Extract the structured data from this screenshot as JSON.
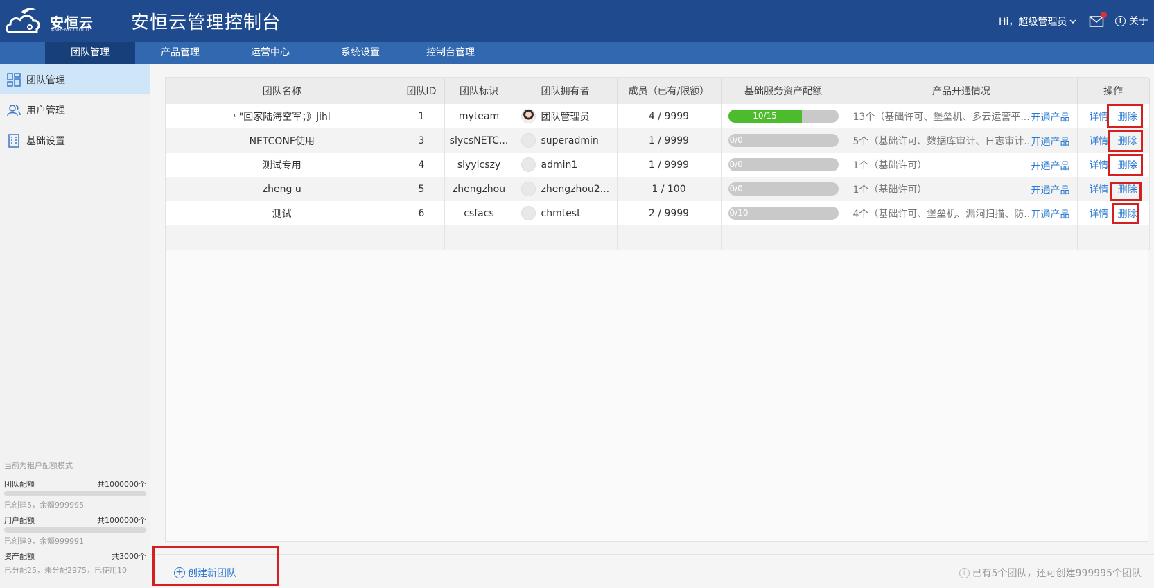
{
  "header": {
    "logo_text": "安恒云",
    "logo_sub": "ANHENG CLOUD",
    "app_title": "安恒云管理控制台",
    "user_greeting": "Hi，超级管理员",
    "about_label": "关于"
  },
  "nav": [
    "团队管理",
    "产品管理",
    "运营中心",
    "系统设置",
    "控制台管理"
  ],
  "sidebar": {
    "items": [
      "团队管理",
      "用户管理",
      "基础设置"
    ],
    "quota_mode": "当前为租户配额模式",
    "quotas": [
      {
        "label": "团队配额",
        "total": "共1000000个",
        "sub": "已创建5，余额999995"
      },
      {
        "label": "用户配额",
        "total": "共1000000个",
        "sub": "已创建9，余额999991"
      },
      {
        "label": "资产配额",
        "total": "共3000个",
        "sub": "已分配25，未分配2975，已使用10"
      }
    ]
  },
  "table": {
    "headers": [
      "团队名称",
      "团队ID",
      "团队标识",
      "团队拥有者",
      "成员（已有/限额）",
      "基础服务资产配额",
      "产品开通情况",
      "操作"
    ],
    "rows": [
      {
        "name": "ᶦ                 \"回家陆海空军；》jihi",
        "id": "1",
        "tag": "myteam",
        "owner": "团队管理员",
        "members": "4 / 9999",
        "quota_label": "10/15",
        "quota_fraction": 0.667,
        "products": "13个（基础许可、堡垒机、多云运营平...",
        "open_label": "开通产品",
        "detail_label": "详情",
        "delete_label": "删除"
      },
      {
        "name": "NETCONF使用",
        "id": "3",
        "tag": "slycsNETC...",
        "owner": "superadmin",
        "members": "1 / 9999",
        "quota_label": "0/0",
        "quota_fraction": 0,
        "products": "5个（基础许可、数据库审计、日志审计...",
        "open_label": "开通产品",
        "detail_label": "详情",
        "delete_label": "删除"
      },
      {
        "name": "测试专用",
        "id": "4",
        "tag": "slyylcszy",
        "owner": "admin1",
        "members": "1 / 9999",
        "quota_label": "0/0",
        "quota_fraction": 0,
        "products": "1个（基础许可）",
        "open_label": "开通产品",
        "detail_label": "详情",
        "delete_label": "删除"
      },
      {
        "name": "zheng   u",
        "id": "5",
        "tag": "zhengzhou",
        "owner": "zhengzhou2...",
        "members": "1 / 100",
        "quota_label": "0/0",
        "quota_fraction": 0,
        "products": "1个（基础许可）",
        "open_label": "开通产品",
        "detail_label": "详情",
        "delete_label": "删除"
      },
      {
        "name": "测试",
        "id": "6",
        "tag": "csfacs",
        "owner": "chmtest",
        "members": "2 / 9999",
        "quota_label": "0/10",
        "quota_fraction": 0,
        "products": "4个（基础许可、堡垒机、漏洞扫描、防...",
        "open_label": "开通产品",
        "detail_label": "详情",
        "delete_label": "删除"
      }
    ]
  },
  "footer": {
    "create_label": "创建新团队",
    "info": "已有5个团队，还可创建999995个团队"
  },
  "colors": {
    "header": "#1f4a8e",
    "nav": "#3168b0",
    "nav_active": "#173f7a",
    "progress": "#4cbb2c",
    "link": "#2a7ad1",
    "highlight": "#d62020"
  }
}
